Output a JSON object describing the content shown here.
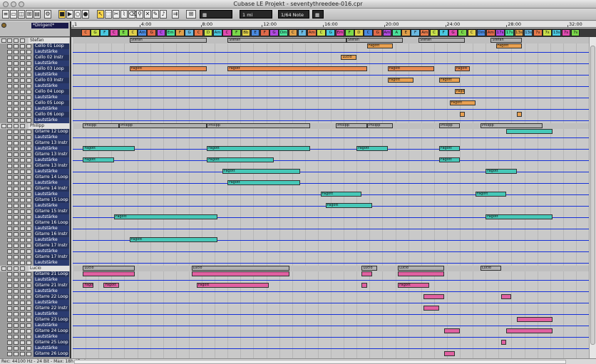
{
  "window": {
    "title": "Cubase LE Projekt - seventythreedee-016.cpr"
  },
  "toolbar": {
    "quantize_value": "1 mi",
    "grid_value": "1/64 Note",
    "tools": [
      "arrow-tool-icon",
      "range-tool-icon",
      "split-tool-icon",
      "glue-tool-icon",
      "erase-tool-icon",
      "zoom-tool-icon",
      "mute-tool-icon",
      "draw-tool-icon",
      "speaker-tool-icon"
    ]
  },
  "ruler": {
    "labels": [
      "1",
      "4:00",
      "8:00",
      "12:00",
      "16:00",
      "20:00",
      "24:00",
      "28:00",
      "32:00"
    ]
  },
  "marker_track": {
    "name": "*Dirigent*"
  },
  "chords": [
    "C",
    "G",
    "F",
    "C",
    "E",
    "C",
    "Am",
    "G",
    "C",
    "Em",
    "F",
    "G",
    "C",
    "D",
    "Am",
    "C",
    "F",
    "Bb",
    "E",
    "F",
    "G",
    "Dm",
    "C",
    "F",
    "Am",
    "C",
    "G",
    "Em",
    "F",
    "D",
    "C",
    "G",
    "Am",
    "A",
    "E",
    "F",
    "Am",
    "C",
    "F",
    "G",
    "C",
    "C",
    "Dm",
    "Am",
    "17s",
    "17s",
    "13s",
    "13s",
    "7s",
    "7s",
    "13s",
    "7s",
    "7s"
  ],
  "chord_colors": [
    "#e87a4a",
    "#c8e04a",
    "#4ac8e0",
    "#e04ab0",
    "#7ad84a",
    "#e0d04a",
    "#4a8ae0",
    "#e06a4a",
    "#b04ae0",
    "#4ae09a",
    "#e0a04a",
    "#6ab8e0"
  ],
  "tracks": [
    {
      "name": "Stefan",
      "kind": "folder"
    },
    {
      "name": "Cello 01 Loop",
      "kind": "track"
    },
    {
      "name": "Lautstärke",
      "kind": "auto"
    },
    {
      "name": "Cello 02 Instr",
      "kind": "track"
    },
    {
      "name": "Lautstärke",
      "kind": "auto"
    },
    {
      "name": "Cello 03 Loop",
      "kind": "track"
    },
    {
      "name": "Lautstärke",
      "kind": "auto"
    },
    {
      "name": "Cello 03 Instr",
      "kind": "track"
    },
    {
      "name": "Lautstärke",
      "kind": "auto"
    },
    {
      "name": "Cello 04 Loop",
      "kind": "track"
    },
    {
      "name": "Lautstärke",
      "kind": "auto"
    },
    {
      "name": "Cello 05 Loop",
      "kind": "track"
    },
    {
      "name": "Lautstärke",
      "kind": "auto"
    },
    {
      "name": "Cello 06 Loop",
      "kind": "track"
    },
    {
      "name": "Lautstärke",
      "kind": "auto"
    },
    {
      "name": "Philipp",
      "kind": "folder"
    },
    {
      "name": "Gitarre 12 Loop",
      "kind": "track"
    },
    {
      "name": "Lautstärke",
      "kind": "auto"
    },
    {
      "name": "Gitarre 13 Instr",
      "kind": "track"
    },
    {
      "name": "Lautstärke",
      "kind": "auto"
    },
    {
      "name": "Gitarre 13 Instr",
      "kind": "track"
    },
    {
      "name": "Lautstärke",
      "kind": "auto"
    },
    {
      "name": "Gitarre 13 Instr",
      "kind": "track"
    },
    {
      "name": "Lautstärke",
      "kind": "auto"
    },
    {
      "name": "Gitarre 14 Loop",
      "kind": "track"
    },
    {
      "name": "Lautstärke",
      "kind": "auto"
    },
    {
      "name": "Gitarre 14 Instr",
      "kind": "track"
    },
    {
      "name": "Lautstärke",
      "kind": "auto"
    },
    {
      "name": "Gitarre 15 Loop",
      "kind": "track"
    },
    {
      "name": "Lautstärke",
      "kind": "auto"
    },
    {
      "name": "Gitarre 15 Instr",
      "kind": "track"
    },
    {
      "name": "Lautstärke",
      "kind": "auto"
    },
    {
      "name": "Gitarre 16 Loop",
      "kind": "track"
    },
    {
      "name": "Lautstärke",
      "kind": "auto"
    },
    {
      "name": "Gitarre 16 Instr",
      "kind": "track"
    },
    {
      "name": "Lautstärke",
      "kind": "auto"
    },
    {
      "name": "Gitarre 17 Instr",
      "kind": "track"
    },
    {
      "name": "Lautstärke",
      "kind": "auto"
    },
    {
      "name": "Gitarre 17 Instr",
      "kind": "track"
    },
    {
      "name": "Lautstärke",
      "kind": "auto"
    },
    {
      "name": "Lucio",
      "kind": "folder"
    },
    {
      "name": "Gitarre 21 Loop",
      "kind": "track"
    },
    {
      "name": "Lautstärke",
      "kind": "auto"
    },
    {
      "name": "Gitarre 21 Instr",
      "kind": "track"
    },
    {
      "name": "Lautstärke",
      "kind": "auto"
    },
    {
      "name": "Gitarre 22 Loop",
      "kind": "track"
    },
    {
      "name": "Lautstärke",
      "kind": "auto"
    },
    {
      "name": "Gitarre 22 Instr",
      "kind": "track"
    },
    {
      "name": "Lautstärke",
      "kind": "auto"
    },
    {
      "name": "Gitarre 23 Loop",
      "kind": "track"
    },
    {
      "name": "Lautstärke",
      "kind": "auto"
    },
    {
      "name": "Gitarre 24 Loop",
      "kind": "track"
    },
    {
      "name": "Lautstärke",
      "kind": "auto"
    },
    {
      "name": "Gitarre 25 Loop",
      "kind": "track"
    },
    {
      "name": "Lautstärke",
      "kind": "auto"
    },
    {
      "name": "Gitarre 26 Loop",
      "kind": "track"
    }
  ],
  "parts": [
    {
      "lane": 0,
      "start": 0.11,
      "end": 0.26,
      "label": "Stefan",
      "color": "#b0b0b0"
    },
    {
      "lane": 0,
      "start": 0.3,
      "end": 0.53,
      "label": "Stefan",
      "color": "#b0b0b0"
    },
    {
      "lane": 0,
      "start": 0.53,
      "end": 0.64,
      "label": "Stefan",
      "color": "#b0b0b0"
    },
    {
      "lane": 0,
      "start": 0.67,
      "end": 0.76,
      "label": "Stefan",
      "color": "#b0b0b0"
    },
    {
      "lane": 0,
      "start": 0.81,
      "end": 0.87,
      "label": "Stefan",
      "color": "#b0b0b0"
    },
    {
      "lane": 1,
      "start": 0.57,
      "end": 0.62,
      "label": "Fagott",
      "color": "#e8a050"
    },
    {
      "lane": 1,
      "start": 0.82,
      "end": 0.87,
      "label": "Fagott",
      "color": "#e8a050"
    },
    {
      "lane": 3,
      "start": 0.52,
      "end": 0.55,
      "label": "Lucio",
      "color": "#e8a050"
    },
    {
      "lane": 5,
      "start": 0.11,
      "end": 0.26,
      "label": "Fagott",
      "color": "#e88a50"
    },
    {
      "lane": 5,
      "start": 0.3,
      "end": 0.57,
      "label": "Fagott",
      "color": "#e88a50"
    },
    {
      "lane": 5,
      "start": 0.61,
      "end": 0.7,
      "label": "Fagott",
      "color": "#e88a50"
    },
    {
      "lane": 5,
      "start": 0.74,
      "end": 0.77,
      "label": "Fagott",
      "color": "#e88a50"
    },
    {
      "lane": 7,
      "start": 0.61,
      "end": 0.66,
      "label": "Fagott",
      "color": "#e8a050"
    },
    {
      "lane": 7,
      "start": 0.71,
      "end": 0.75,
      "label": "Fagott",
      "color": "#e8a050"
    },
    {
      "lane": 9,
      "start": 0.74,
      "end": 0.76,
      "label": "Fagott",
      "color": "#e8a050"
    },
    {
      "lane": 11,
      "start": 0.73,
      "end": 0.78,
      "label": "Fagott",
      "color": "#e8a050"
    },
    {
      "lane": 13,
      "start": 0.75,
      "end": 0.76,
      "label": "",
      "color": "#e8a050"
    },
    {
      "lane": 13,
      "start": 0.86,
      "end": 0.87,
      "label": "",
      "color": "#e8a050"
    },
    {
      "lane": 15,
      "start": 0.02,
      "end": 0.09,
      "label": "Philipp",
      "color": "#b0b0b0"
    },
    {
      "lane": 15,
      "start": 0.09,
      "end": 0.26,
      "label": "Philipp",
      "color": "#b0b0b0"
    },
    {
      "lane": 15,
      "start": 0.26,
      "end": 0.46,
      "label": "Philipp",
      "color": "#b0b0b0"
    },
    {
      "lane": 15,
      "start": 0.51,
      "end": 0.57,
      "label": "Philipp",
      "color": "#b0b0b0"
    },
    {
      "lane": 15,
      "start": 0.57,
      "end": 0.62,
      "label": "Philipp",
      "color": "#b0b0b0"
    },
    {
      "lane": 15,
      "start": 0.71,
      "end": 0.75,
      "label": "Philipp",
      "color": "#b0b0b0"
    },
    {
      "lane": 15,
      "start": 0.79,
      "end": 0.91,
      "label": "Philipp",
      "color": "#b0b0b0"
    },
    {
      "lane": 16,
      "start": 0.84,
      "end": 0.93,
      "label": "",
      "color": "#46c8b8"
    },
    {
      "lane": 19,
      "start": 0.02,
      "end": 0.12,
      "label": "Fagott",
      "color": "#46c8b8"
    },
    {
      "lane": 19,
      "start": 0.26,
      "end": 0.46,
      "label": "Fagott",
      "color": "#46c8b8"
    },
    {
      "lane": 19,
      "start": 0.55,
      "end": 0.61,
      "label": "Fagott",
      "color": "#46c8b8"
    },
    {
      "lane": 19,
      "start": 0.71,
      "end": 0.75,
      "label": "Fagott",
      "color": "#46c8b8"
    },
    {
      "lane": 21,
      "start": 0.02,
      "end": 0.08,
      "label": "Fagott",
      "color": "#46c8b8"
    },
    {
      "lane": 21,
      "start": 0.26,
      "end": 0.39,
      "label": "Fagott",
      "color": "#46c8b8"
    },
    {
      "lane": 21,
      "start": 0.71,
      "end": 0.75,
      "label": "Fagott",
      "color": "#46c8b8"
    },
    {
      "lane": 23,
      "start": 0.29,
      "end": 0.44,
      "label": "Fagott",
      "color": "#46c8b8"
    },
    {
      "lane": 23,
      "start": 0.8,
      "end": 0.86,
      "label": "Fagott",
      "color": "#46c8b8"
    },
    {
      "lane": 25,
      "start": 0.3,
      "end": 0.44,
      "label": "Fagott",
      "color": "#46c8b8"
    },
    {
      "lane": 27,
      "start": 0.48,
      "end": 0.56,
      "label": "Fagott",
      "color": "#46c8b8"
    },
    {
      "lane": 27,
      "start": 0.78,
      "end": 0.84,
      "label": "Fagott",
      "color": "#46c8b8"
    },
    {
      "lane": 29,
      "start": 0.49,
      "end": 0.58,
      "label": "Fagott",
      "color": "#46c8b8"
    },
    {
      "lane": 31,
      "start": 0.08,
      "end": 0.28,
      "label": "Fagott",
      "color": "#46c8b8"
    },
    {
      "lane": 31,
      "start": 0.8,
      "end": 0.93,
      "label": "Fagott",
      "color": "#46c8b8"
    },
    {
      "lane": 35,
      "start": 0.11,
      "end": 0.28,
      "label": "Fagott",
      "color": "#46c8b8"
    },
    {
      "lane": 40,
      "start": 0.02,
      "end": 0.12,
      "label": "Lucio",
      "color": "#b0b0b0"
    },
    {
      "lane": 40,
      "start": 0.23,
      "end": 0.42,
      "label": "Lucio",
      "color": "#b0b0b0"
    },
    {
      "lane": 40,
      "start": 0.56,
      "end": 0.59,
      "label": "Lucio",
      "color": "#b0b0b0"
    },
    {
      "lane": 40,
      "start": 0.63,
      "end": 0.72,
      "label": "Lucio",
      "color": "#b0b0b0"
    },
    {
      "lane": 40,
      "start": 0.79,
      "end": 0.83,
      "label": "Lucio",
      "color": "#b0b0b0"
    },
    {
      "lane": 41,
      "start": 0.02,
      "end": 0.12,
      "label": "",
      "color": "#e060a0"
    },
    {
      "lane": 41,
      "start": 0.23,
      "end": 0.42,
      "label": "",
      "color": "#e060a0"
    },
    {
      "lane": 41,
      "start": 0.56,
      "end": 0.58,
      "label": "",
      "color": "#e060a0"
    },
    {
      "lane": 41,
      "start": 0.63,
      "end": 0.72,
      "label": "",
      "color": "#e060a0"
    },
    {
      "lane": 43,
      "start": 0.02,
      "end": 0.04,
      "label": "Fagott",
      "color": "#e060a0"
    },
    {
      "lane": 43,
      "start": 0.06,
      "end": 0.09,
      "label": "Fagott",
      "color": "#e060a0"
    },
    {
      "lane": 43,
      "start": 0.24,
      "end": 0.38,
      "label": "Fagott",
      "color": "#e060a0"
    },
    {
      "lane": 43,
      "start": 0.56,
      "end": 0.57,
      "label": "",
      "color": "#e060a0"
    },
    {
      "lane": 43,
      "start": 0.63,
      "end": 0.69,
      "label": "Fagott",
      "color": "#e060a0"
    },
    {
      "lane": 45,
      "start": 0.68,
      "end": 0.72,
      "label": "",
      "color": "#e060a0"
    },
    {
      "lane": 45,
      "start": 0.83,
      "end": 0.85,
      "label": "",
      "color": "#e060a0"
    },
    {
      "lane": 47,
      "start": 0.68,
      "end": 0.71,
      "label": "",
      "color": "#e060a0"
    },
    {
      "lane": 49,
      "start": 0.86,
      "end": 0.93,
      "label": "",
      "color": "#e060a0"
    },
    {
      "lane": 51,
      "start": 0.72,
      "end": 0.75,
      "label": "",
      "color": "#e060a0"
    },
    {
      "lane": 51,
      "start": 0.84,
      "end": 0.93,
      "label": "",
      "color": "#e060a0"
    },
    {
      "lane": 53,
      "start": 0.83,
      "end": 0.84,
      "label": "",
      "color": "#e060a0"
    },
    {
      "lane": 55,
      "start": 0.72,
      "end": 0.74,
      "label": "",
      "color": "#e060a0"
    }
  ],
  "status": {
    "text": "Rec: 44100 Hz - 24 Bit - Max: 18h 47min"
  }
}
